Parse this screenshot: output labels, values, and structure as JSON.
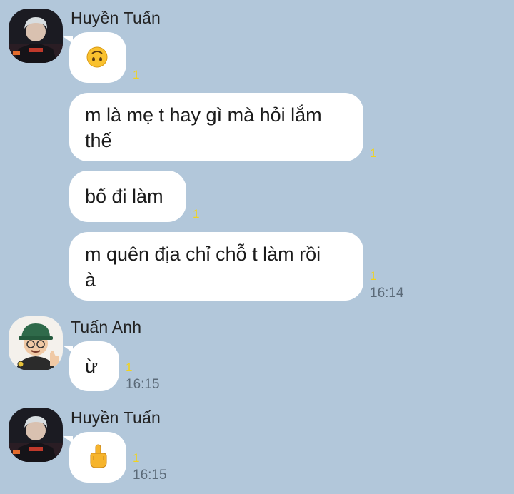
{
  "colors": {
    "background": "#b2c7da",
    "bubble": "#ffffff",
    "unread": "#f2d31b",
    "time": "#5b6a78"
  },
  "messages": [
    {
      "sender": "Huyền Tuấn",
      "avatar": "avatar-huyen-tuan",
      "content_icon": "upside-down-face-emoji",
      "unread": "1"
    },
    {
      "text": "m là mẹ t hay gì mà hỏi lắm thế",
      "line1": "m là mẹ t hay gì mà hỏi lắm",
      "line2": "thế",
      "unread": "1"
    },
    {
      "text": "bố đi làm",
      "unread": "1"
    },
    {
      "text": "m quên địa chỉ chỗ t làm rồi à",
      "line1": "m quên địa chỉ chỗ t làm rồi",
      "line2": "à",
      "unread": "1",
      "time": "16:14"
    },
    {
      "sender": "Tuấn Anh",
      "avatar": "avatar-tuan-anh",
      "text": "ừ",
      "unread": "1",
      "time": "16:15"
    },
    {
      "sender": "Huyền Tuấn",
      "avatar": "avatar-huyen-tuan",
      "content_icon": "middle-finger-emoji",
      "unread": "1",
      "time": "16:15"
    }
  ]
}
